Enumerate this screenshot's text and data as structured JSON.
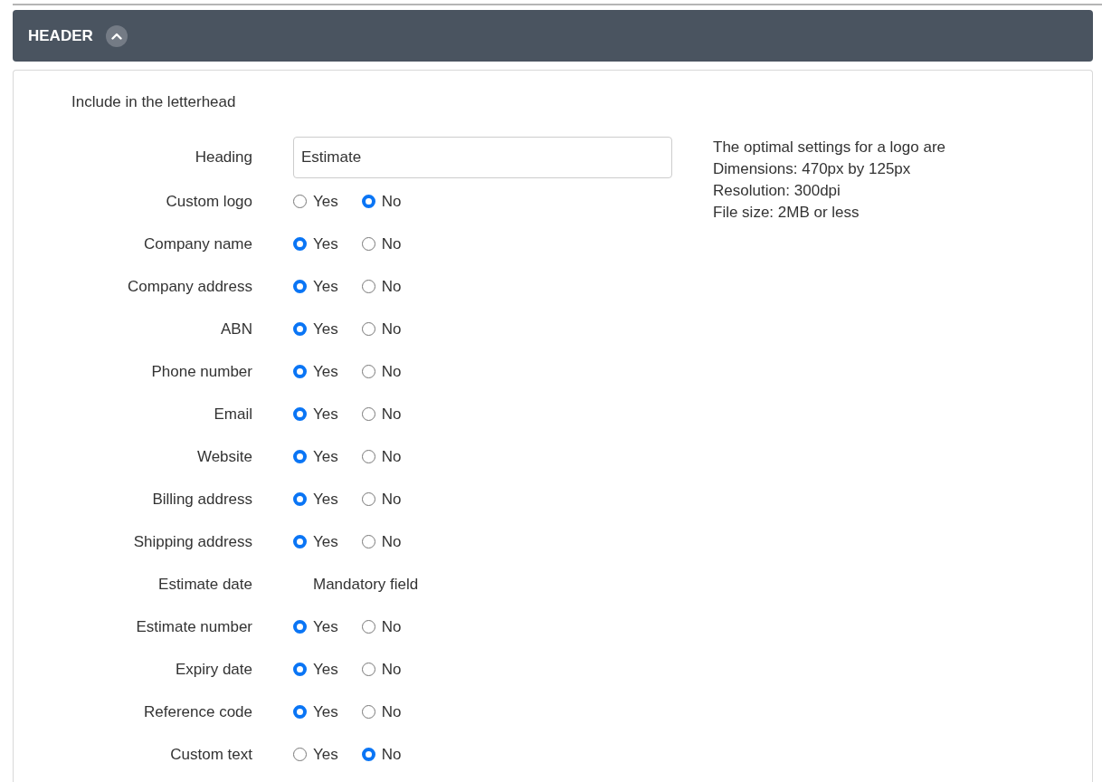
{
  "section": {
    "title": "HEADER",
    "expanded": true
  },
  "intro": "Include in the letterhead",
  "rows": [
    {
      "kind": "text_input",
      "label": "Heading",
      "value": "Estimate"
    },
    {
      "kind": "radio",
      "label": "Custom logo",
      "options": [
        {
          "label": "Yes",
          "selected": false
        },
        {
          "label": "No",
          "selected": true
        }
      ]
    },
    {
      "kind": "radio",
      "label": "Company name",
      "options": [
        {
          "label": "Yes",
          "selected": true
        },
        {
          "label": "No",
          "selected": false
        }
      ]
    },
    {
      "kind": "radio",
      "label": "Company address",
      "options": [
        {
          "label": "Yes",
          "selected": true
        },
        {
          "label": "No",
          "selected": false
        }
      ]
    },
    {
      "kind": "radio",
      "label": "ABN",
      "options": [
        {
          "label": "Yes",
          "selected": true
        },
        {
          "label": "No",
          "selected": false
        }
      ]
    },
    {
      "kind": "radio",
      "label": "Phone number",
      "options": [
        {
          "label": "Yes",
          "selected": true
        },
        {
          "label": "No",
          "selected": false
        }
      ]
    },
    {
      "kind": "radio",
      "label": "Email",
      "options": [
        {
          "label": "Yes",
          "selected": true
        },
        {
          "label": "No",
          "selected": false
        }
      ]
    },
    {
      "kind": "radio",
      "label": "Website",
      "options": [
        {
          "label": "Yes",
          "selected": true
        },
        {
          "label": "No",
          "selected": false
        }
      ]
    },
    {
      "kind": "radio",
      "label": "Billing address",
      "options": [
        {
          "label": "Yes",
          "selected": true
        },
        {
          "label": "No",
          "selected": false
        }
      ]
    },
    {
      "kind": "radio",
      "label": "Shipping address",
      "options": [
        {
          "label": "Yes",
          "selected": true
        },
        {
          "label": "No",
          "selected": false
        }
      ]
    },
    {
      "kind": "note",
      "label": "Estimate date",
      "note": "Mandatory field"
    },
    {
      "kind": "radio",
      "label": "Estimate number",
      "options": [
        {
          "label": "Yes",
          "selected": true
        },
        {
          "label": "No",
          "selected": false
        }
      ]
    },
    {
      "kind": "radio",
      "label": "Expiry date",
      "options": [
        {
          "label": "Yes",
          "selected": true
        },
        {
          "label": "No",
          "selected": false
        }
      ]
    },
    {
      "kind": "radio",
      "label": "Reference code",
      "options": [
        {
          "label": "Yes",
          "selected": true
        },
        {
          "label": "No",
          "selected": false
        }
      ]
    },
    {
      "kind": "radio",
      "label": "Custom text",
      "options": [
        {
          "label": "Yes",
          "selected": false
        },
        {
          "label": "No",
          "selected": true
        }
      ]
    }
  ],
  "logo_tips": [
    "The optimal settings for a logo are",
    "Dimensions: 470px by 125px",
    "Resolution: 300dpi",
    "File size: 2MB or less"
  ]
}
